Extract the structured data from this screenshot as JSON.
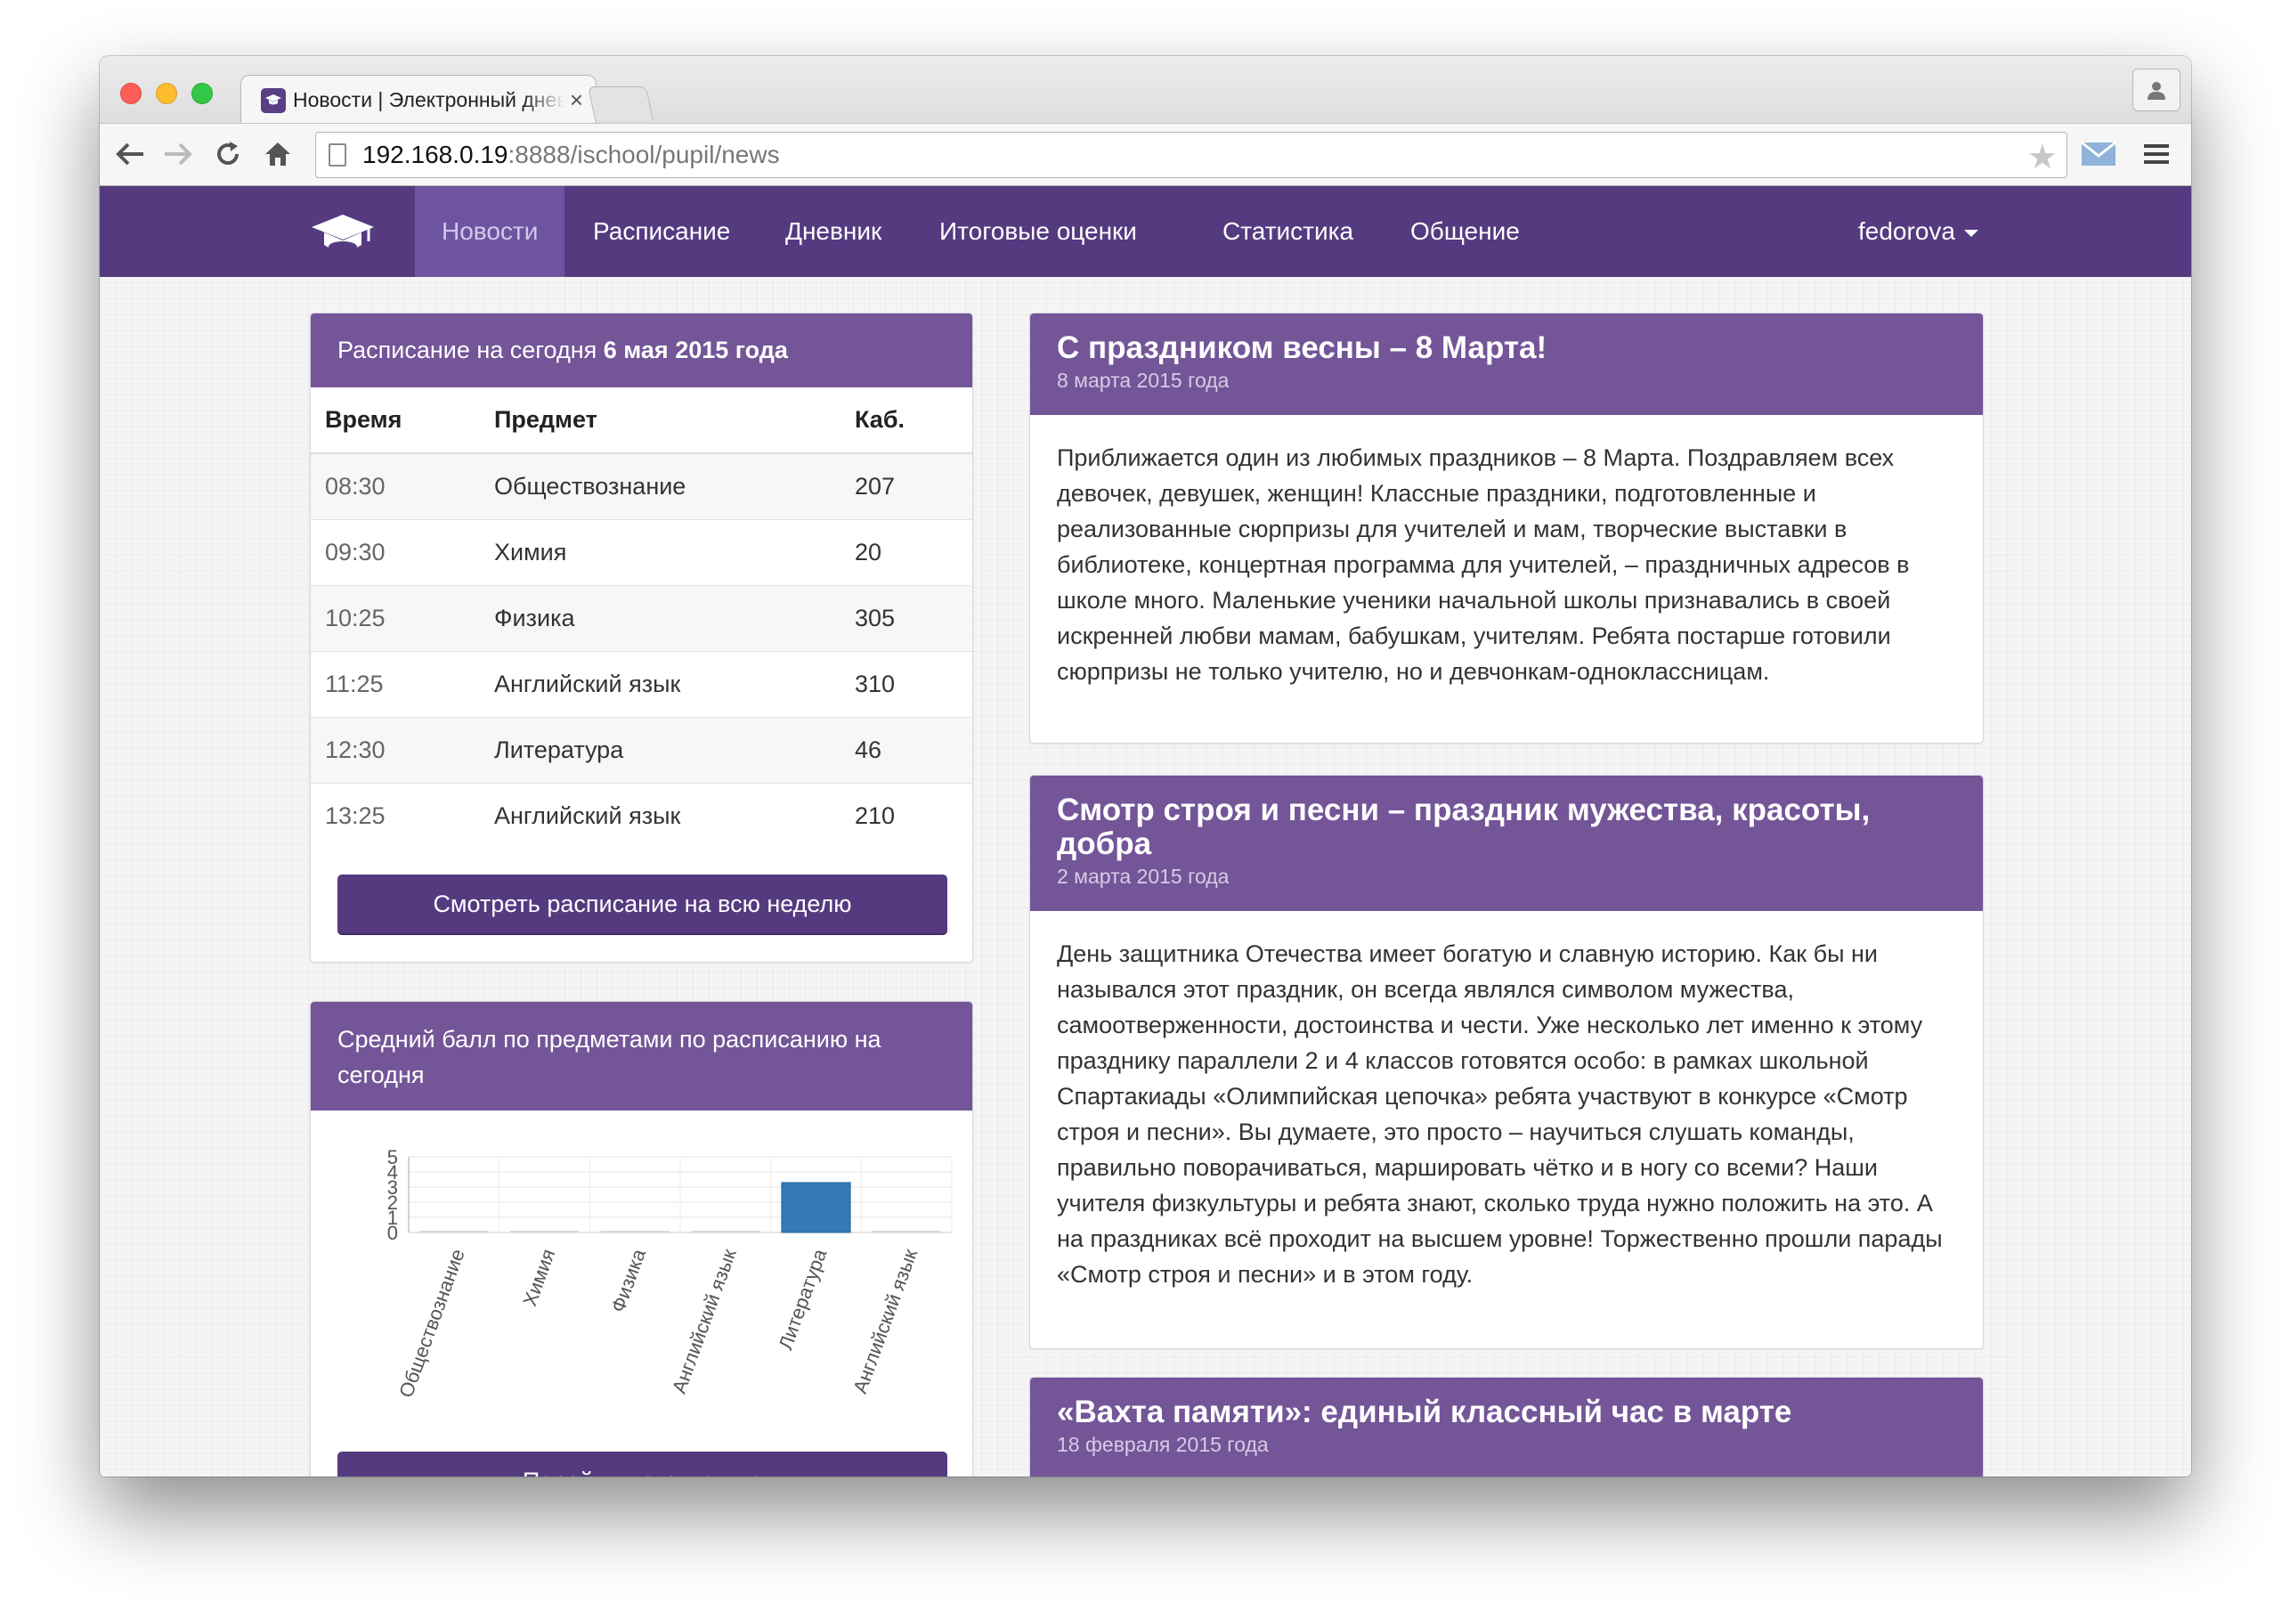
{
  "browser": {
    "tab_title": "Новости | Электронный дневник",
    "tab_close": "×",
    "url_host": "192.168.0.19",
    "url_path": ":8888/ischool/pupil/news",
    "star": "★"
  },
  "nav": {
    "items": [
      "Новости",
      "Расписание",
      "Дневник",
      "Итоговые оценки",
      "Статистика",
      "Общение"
    ],
    "active": "Новости",
    "user": "fedorova"
  },
  "schedule": {
    "title_prefix": "Расписание на сегодня",
    "title_date": "6 мая 2015 года",
    "headers": [
      "Время",
      "Предмет",
      "Каб."
    ],
    "rows": [
      [
        "08:30",
        "Обществознание",
        "207"
      ],
      [
        "09:30",
        "Химия",
        "20"
      ],
      [
        "10:25",
        "Физика",
        "305"
      ],
      [
        "11:25",
        "Английский язык",
        "310"
      ],
      [
        "12:30",
        "Литература",
        "46"
      ],
      [
        "13:25",
        "Английский язык",
        "210"
      ]
    ],
    "week_button": "Смотреть расписание на всю неделю"
  },
  "avg_panel": {
    "title": "Средний балл по предметами по расписанию на сегодня",
    "stats_button": "Перейти к статистике"
  },
  "chart_data": {
    "type": "bar",
    "categories": [
      "Обществознание",
      "Химия",
      "Физика",
      "Английский язык",
      "Литература",
      "Английский язык"
    ],
    "values": [
      0,
      0,
      0,
      0,
      3.3,
      0
    ],
    "ylim": [
      0,
      5
    ],
    "yticks": [
      "0",
      "1",
      "2",
      "3",
      "4",
      "5"
    ],
    "grid": true,
    "bar_color": "#337ab7"
  },
  "news": [
    {
      "title": "С праздником весны – 8 Марта!",
      "date": "8 марта 2015 года",
      "body": "Приближается один из любимых праздников – 8 Марта. Поздравляем всех девочек, девушек, женщин! Классные праздники, подготовленные и реализованные сюрпризы для учителей и мам, творческие выставки в библиотеке, концертная программа для учителей, – праздничных адресов в школе много. Маленькие ученики начальной школы признавались в своей искренней любви мамам, бабушкам, учителям. Ребята постарше готовили сюрпризы не только учителю, но и девчонкам-одноклассницам."
    },
    {
      "title": "Смотр строя и песни – праздник мужества, красоты, добра",
      "date": "2 марта 2015 года",
      "body": "День защитника Отечества имеет богатую и славную историю. Как бы ни назывался этот праздник, он всегда являлся символом мужества, самоотверженности, достоинства и чести. Уже несколько лет именно к этому празднику параллели 2 и 4 классов готовятся особо: в рамках школьной Спартакиады «Олимпийская цепочка» ребята участвуют в конкурсе «Смотр строя и песни». Вы думаете, это просто – научиться слушать команды, правильно поворачиваться, маршировать чётко и в ногу со всеми? Наши учителя физкультуры и ребята знают, сколько труда нужно положить на это. А на праздниках всё проходит на высшем уровне! Торжественно прошли парады «Смотр строя и песни» и в этом году."
    },
    {
      "title": "«Вахта памяти»: единый классный час в марте",
      "date": "18 февраля 2015 года",
      "body": ""
    }
  ],
  "colors": {
    "navbar": "#553a80",
    "panel_header": "#735598",
    "bar": "#337ab7"
  }
}
